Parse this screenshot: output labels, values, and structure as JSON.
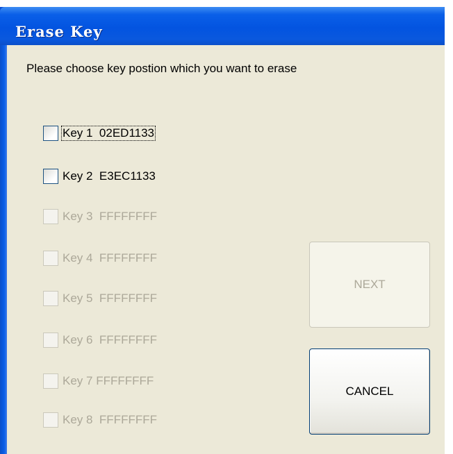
{
  "window": {
    "title": "Erase Key"
  },
  "prompt": "Please choose key postion which you want to erase",
  "keys": [
    {
      "label": "Key 1  02ED1133",
      "enabled": true,
      "checked": false,
      "focused": true
    },
    {
      "label": "Key 2  E3EC1133",
      "enabled": true,
      "checked": false,
      "focused": false
    },
    {
      "label": "Key 3  FFFFFFFF",
      "enabled": false,
      "checked": false,
      "focused": false
    },
    {
      "label": "Key 4  FFFFFFFF",
      "enabled": false,
      "checked": false,
      "focused": false
    },
    {
      "label": "Key 5  FFFFFFFF",
      "enabled": false,
      "checked": false,
      "focused": false
    },
    {
      "label": "Key 6  FFFFFFFF",
      "enabled": false,
      "checked": false,
      "focused": false
    },
    {
      "label": "Key 7 FFFFFFFF",
      "enabled": false,
      "checked": false,
      "focused": false
    },
    {
      "label": "Key 8  FFFFFFFF",
      "enabled": false,
      "checked": false,
      "focused": false
    }
  ],
  "buttons": {
    "next": {
      "label": "NEXT",
      "enabled": false
    },
    "cancel": {
      "label": "CANCEL",
      "enabled": true
    }
  },
  "colors": {
    "titlebar": "#0354e0",
    "dialog_bg": "#ece9d8",
    "disabled_text": "#aca899",
    "checkbox_border": "#1c5180"
  }
}
